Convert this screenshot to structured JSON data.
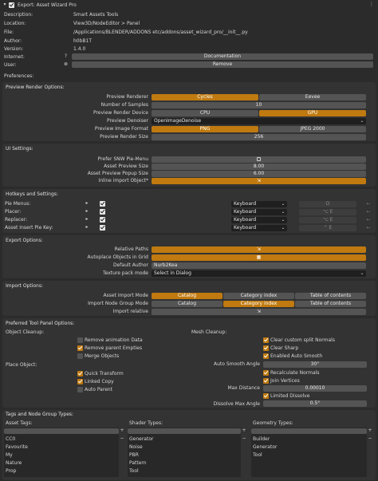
{
  "header": {
    "title": "Export: Asset Wizard Pro",
    "info": [
      {
        "label": "Description:",
        "value": "Smart Assets Tools"
      },
      {
        "label": "Location:",
        "value": "View3D/NodeEditor > Panel"
      },
      {
        "label": "File:",
        "value": "/Applications/BLENDER/ADDONS etc/addons/asset_wizard_pro/__init__.py"
      },
      {
        "label": "Author:",
        "value": "h0bB1T"
      },
      {
        "label": "Version:",
        "value": "1.4.0"
      }
    ],
    "internet_label": "Internet:",
    "documentation_label": "Documentation",
    "user_label": "User:",
    "remove_label": "Remove"
  },
  "preferences_label": "Preferences:",
  "preview": {
    "title": "Preview Render Options:",
    "renderer_label": "Preview Renderer",
    "renderer_options": [
      "Cycles",
      "Eevee"
    ],
    "samples_label": "Number of Samples",
    "samples_value": "10",
    "device_label": "Preview Render Device",
    "device_options": [
      "CPU",
      "GPU"
    ],
    "denoiser_label": "Preview Denoiser",
    "denoiser_value": "OpenImageDenoise",
    "format_label": "Preview Image Format",
    "format_options": [
      "PNG",
      "JPEG 2000"
    ],
    "size_label": "Preview Render Size",
    "size_value": "256"
  },
  "ui": {
    "title": "UI Settings:",
    "pie_label": "Prefer SNW Pie-Menu",
    "asset_size_label": "Asset Preview Size",
    "asset_size_value": "8.00",
    "popup_size_label": "Asset Preview Popup Size",
    "popup_size_value": "6.00",
    "inline_label": "Inline import Object*"
  },
  "hotkeys": {
    "title": "Hotkeys and Settings:",
    "rows": [
      {
        "label": "Pie Menus:",
        "type": "Keyboard",
        "key": "D"
      },
      {
        "label": "Placer:",
        "type": "Keyboard",
        "key": "⌥ E"
      },
      {
        "label": "Replacer:",
        "type": "Keyboard",
        "key": "⌥ E"
      },
      {
        "label": "Asset Insert Pie Key:",
        "type": "Keyboard",
        "key": "⌃ E"
      }
    ]
  },
  "export": {
    "title": "Export Options:",
    "relative_label": "Relative Paths",
    "autoplace_label": "Autoplace Objects in Grid",
    "author_label": "Default Author",
    "author_value": "Nurb2Kea",
    "texture_label": "Texture pack mode",
    "texture_value": "Select in Dialog"
  },
  "import": {
    "title": "Import Options:",
    "mode_label": "Asset Import Mode",
    "mode_options": [
      "Catalog",
      "Category index",
      "Table of contents"
    ],
    "node_label": "Import Node Group Mode",
    "node_options": [
      "Catalog",
      "Category index",
      "Table of contents"
    ],
    "relative_label": "Import relative"
  },
  "tool": {
    "title": "Preferred Tool Panel Options:",
    "object_cleanup": "Object Cleanup:",
    "mesh_cleanup": "Mesh Cleanup:",
    "remove_anim": "Remove animation Data",
    "remove_parent": "Remove parent Empties",
    "merge": "Merge Objects",
    "clear_normals": "Clear custom split Normals",
    "clear_sharp": "Clear Sharp",
    "auto_smooth": "Enabled Auto Smooth",
    "smooth_angle_label": "Auto Smooth Angle",
    "smooth_angle_value": "30°",
    "place_object": "Place Object:",
    "quick_transform": "Quick Transform",
    "linked_copy": "Linked Copy",
    "auto_parent": "Auto Parent",
    "recalc_normals": "Recalculate Normals",
    "join_vertices": "Join Vertices",
    "max_distance_label": "Max Distance",
    "max_distance_value": "0.00010",
    "limited_dissolve": "Limited Dissolve",
    "dissolve_label": "Dissolve Max Angle",
    "dissolve_value": "0.5°"
  },
  "tags": {
    "title": "Tags and Node Group Types:",
    "asset_tags": {
      "title": "Asset Tags:",
      "items": [
        "CC0",
        "Favourite",
        "My",
        "Nature",
        "Prop"
      ]
    },
    "shader_types": {
      "title": "Shader Types:",
      "items": [
        "Generator",
        "Noise",
        "PBR",
        "Pattern",
        "Tool"
      ]
    },
    "geometry_types": {
      "title": "Geometry Types:",
      "items": [
        "Builder",
        "Generator",
        "Tool"
      ]
    }
  },
  "colors": {
    "accent": "#c07a10",
    "background": "#2b2b2b",
    "panel": "#333333",
    "widget": "#545454"
  }
}
